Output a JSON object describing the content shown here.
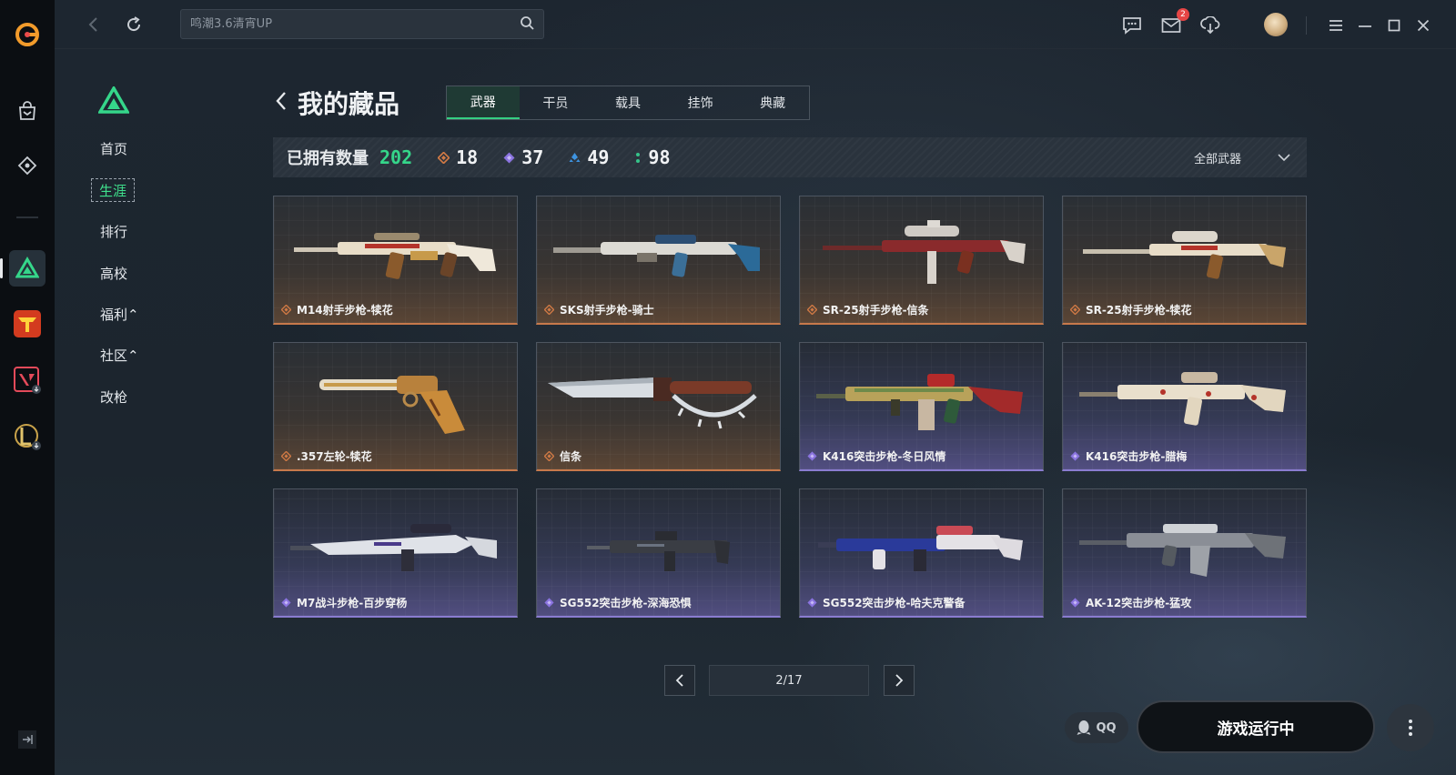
{
  "search": {
    "placeholder": "鸣潮3.6清宵UP"
  },
  "topbar": {
    "mail_badge": "2"
  },
  "sidenav": {
    "items": [
      {
        "label": "首页"
      },
      {
        "label": "生涯"
      },
      {
        "label": "排行"
      },
      {
        "label": "高校"
      },
      {
        "label": "福利⌃"
      },
      {
        "label": "社区⌃"
      },
      {
        "label": "改枪"
      }
    ]
  },
  "header": {
    "title": "我的藏品",
    "tabs": [
      {
        "label": "武器"
      },
      {
        "label": "干员"
      },
      {
        "label": "载具"
      },
      {
        "label": "挂饰"
      },
      {
        "label": "典藏"
      }
    ]
  },
  "summary": {
    "owned_label": "已拥有数量",
    "owned_count": "202",
    "rarity_counts": [
      "18",
      "37",
      "49",
      "98"
    ],
    "filter_label": "全部武器"
  },
  "colors": {
    "accent_green": "#35d68a",
    "gold_rarity": "#d27a45",
    "purple_rarity": "#8b74e0",
    "blue_rarity": "#3d93e0",
    "green_rarity": "#35c48a"
  },
  "items": [
    {
      "name": "M14射手步枪-犊花",
      "rarity": "gold"
    },
    {
      "name": "SKS射手步枪-骑士",
      "rarity": "gold"
    },
    {
      "name": "SR-25射手步枪-信条",
      "rarity": "gold"
    },
    {
      "name": "SR-25射手步枪-犊花",
      "rarity": "gold"
    },
    {
      "name": ".357左轮-犊花",
      "rarity": "gold"
    },
    {
      "name": "信条",
      "rarity": "gold"
    },
    {
      "name": "K416突击步枪-冬日风情",
      "rarity": "purple"
    },
    {
      "name": "K416突击步枪-腊梅",
      "rarity": "purple"
    },
    {
      "name": "M7战斗步枪-百步穿杨",
      "rarity": "purple"
    },
    {
      "name": "SG552突击步枪-深海恐惧",
      "rarity": "purple"
    },
    {
      "name": "SG552突击步枪-哈夫克警备",
      "rarity": "purple"
    },
    {
      "name": "AK-12突击步枪-猛攻",
      "rarity": "purple"
    }
  ],
  "pagination": {
    "label": "2/17"
  },
  "bottom": {
    "qq_label": "QQ",
    "play_label": "游戏运行中"
  }
}
